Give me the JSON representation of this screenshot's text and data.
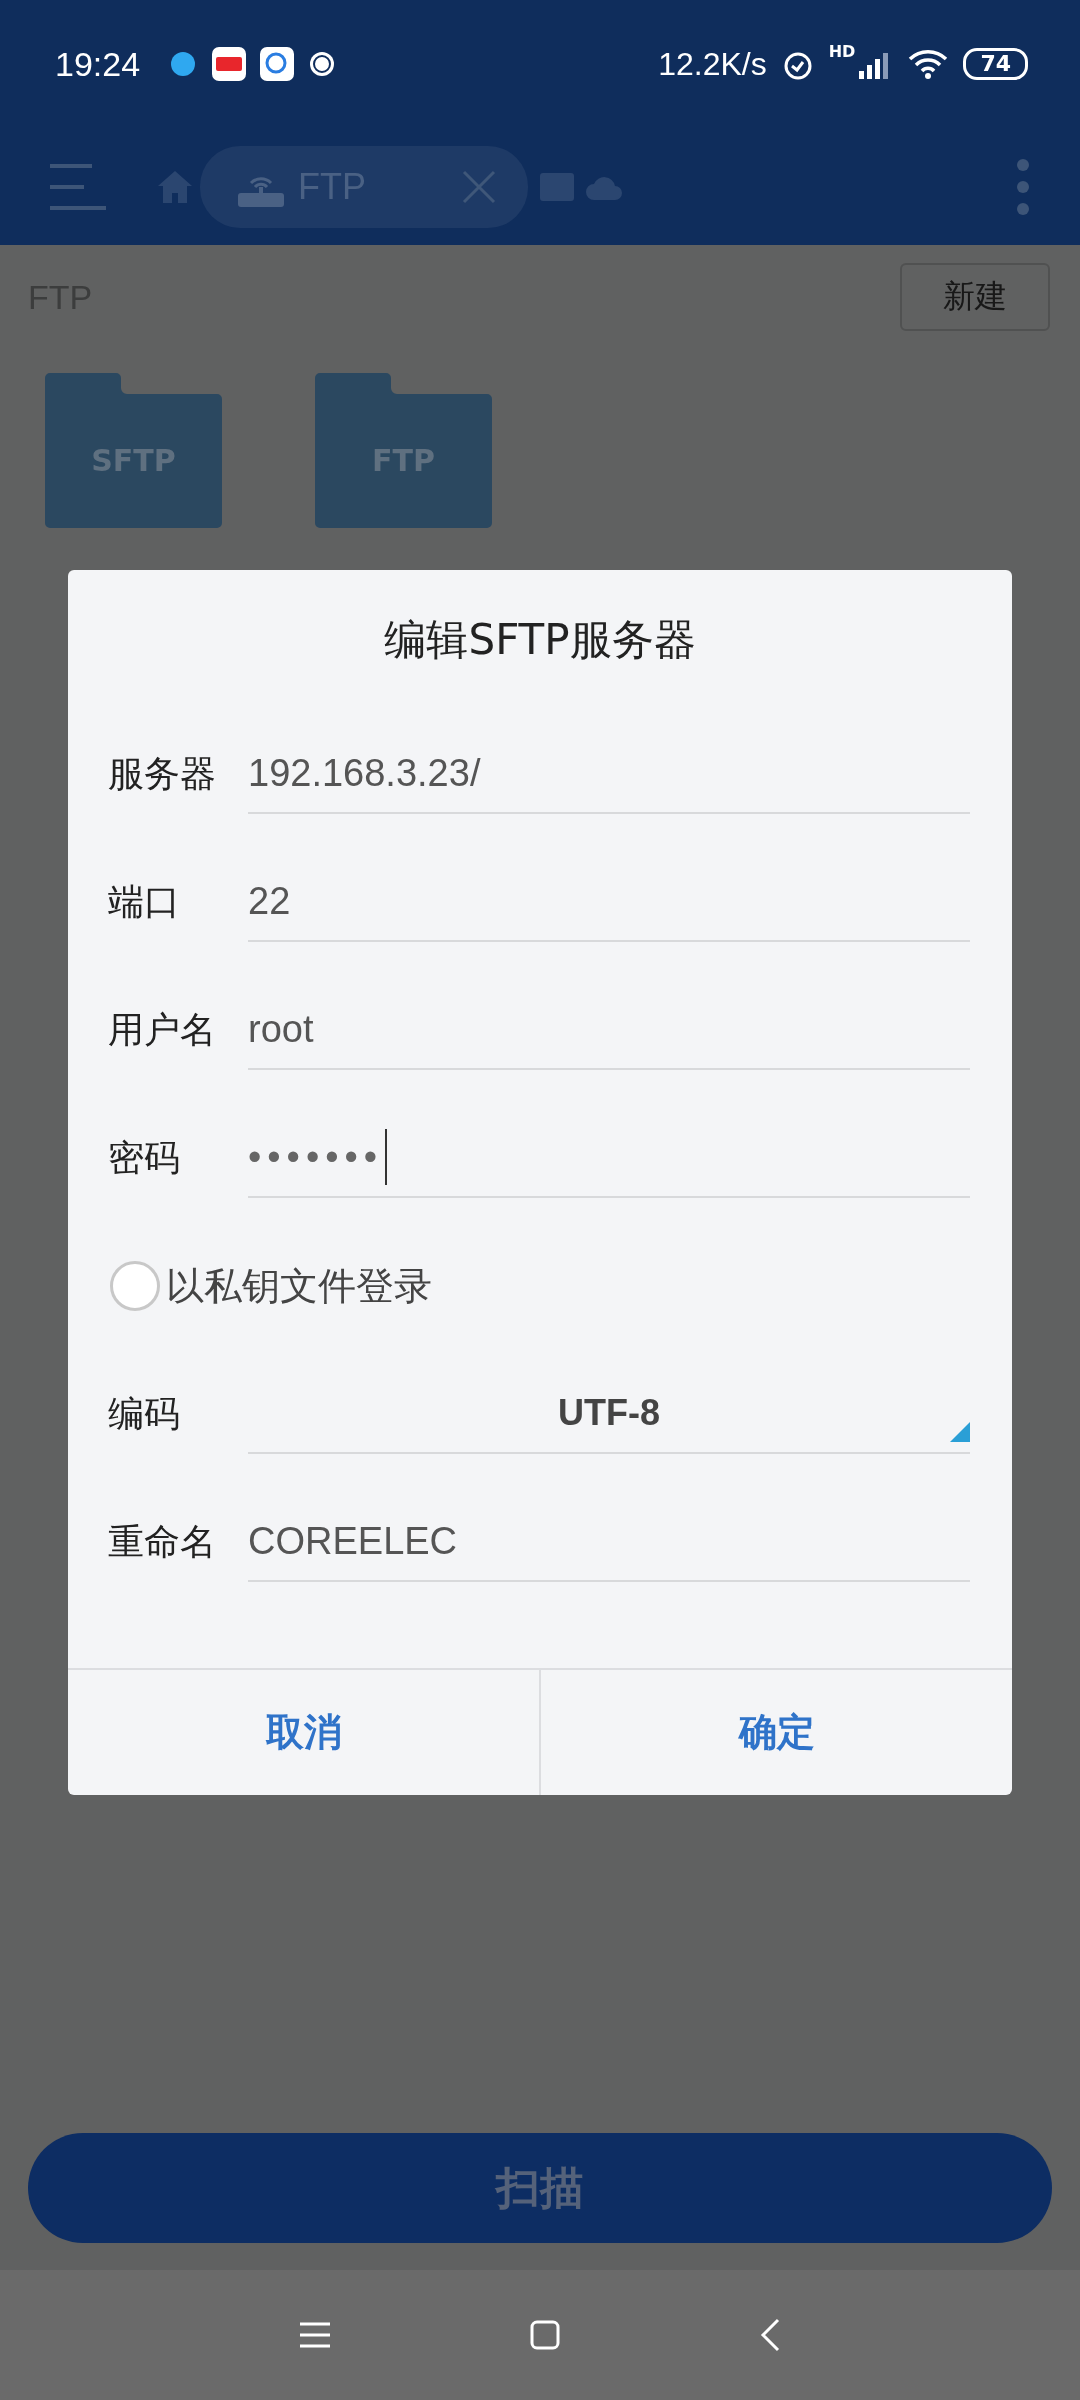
{
  "status_bar": {
    "time": "19:24",
    "net_speed": "12.2K/s",
    "signal_label": "HD",
    "battery": "74"
  },
  "toolbar": {
    "tab_label": "FTP"
  },
  "path": "FTP",
  "new_button": "新建",
  "folders": [
    {
      "badge": "SFTP"
    },
    {
      "badge": "FTP"
    }
  ],
  "dialog": {
    "title": "编辑SFTP服务器",
    "fields": [
      {
        "kind": "text",
        "label": "服务器",
        "value": "192.168.3.23/"
      },
      {
        "kind": "text",
        "label": "端口",
        "value": "22"
      },
      {
        "kind": "text",
        "label": "用户名",
        "value": "root"
      },
      {
        "kind": "password",
        "label": "密码",
        "value": "•••••••"
      },
      {
        "kind": "checkbox",
        "label": "以私钥文件登录",
        "checked": false
      },
      {
        "kind": "select",
        "label": "编码",
        "value": "UTF-8"
      },
      {
        "kind": "text",
        "label": "重命名",
        "value": "COREELEC"
      }
    ],
    "buttons": [
      "取消",
      "确定"
    ]
  },
  "scan_button": "扫描"
}
